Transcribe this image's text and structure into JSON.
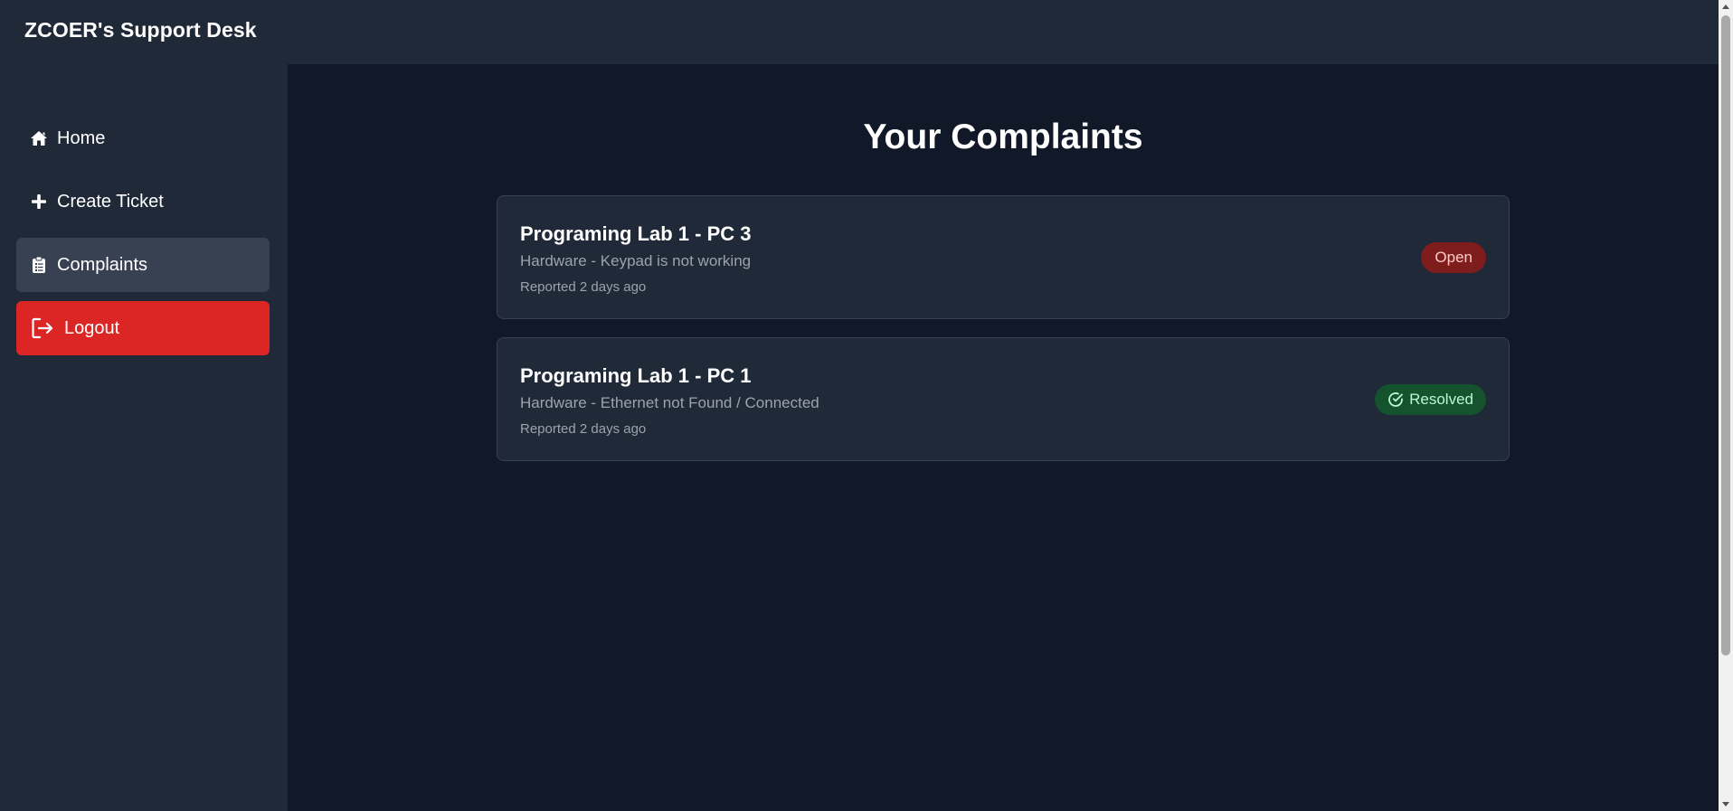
{
  "header": {
    "brand": "ZCOER's Support Desk"
  },
  "sidebar": {
    "items": [
      {
        "label": "Home",
        "icon": "home-icon"
      },
      {
        "label": "Create Ticket",
        "icon": "plus-icon"
      },
      {
        "label": "Complaints",
        "icon": "clipboard-icon",
        "active": true
      },
      {
        "label": "Logout",
        "icon": "logout-icon"
      }
    ]
  },
  "main": {
    "title": "Your Complaints",
    "complaints": [
      {
        "title": "Programing Lab 1 - PC 3",
        "description": "Hardware - Keypad is not working",
        "reported": "Reported 2 days ago",
        "status": "Open"
      },
      {
        "title": "Programing Lab 1 - PC 1",
        "description": "Hardware - Ethernet not Found / Connected",
        "reported": "Reported 2 days ago",
        "status": "Resolved"
      }
    ]
  },
  "colors": {
    "background": "#111827",
    "panel": "#1f2937",
    "active_nav": "#374151",
    "logout": "#dc2626",
    "open_badge": "#7f1d1d",
    "resolved_badge": "#14532d"
  }
}
